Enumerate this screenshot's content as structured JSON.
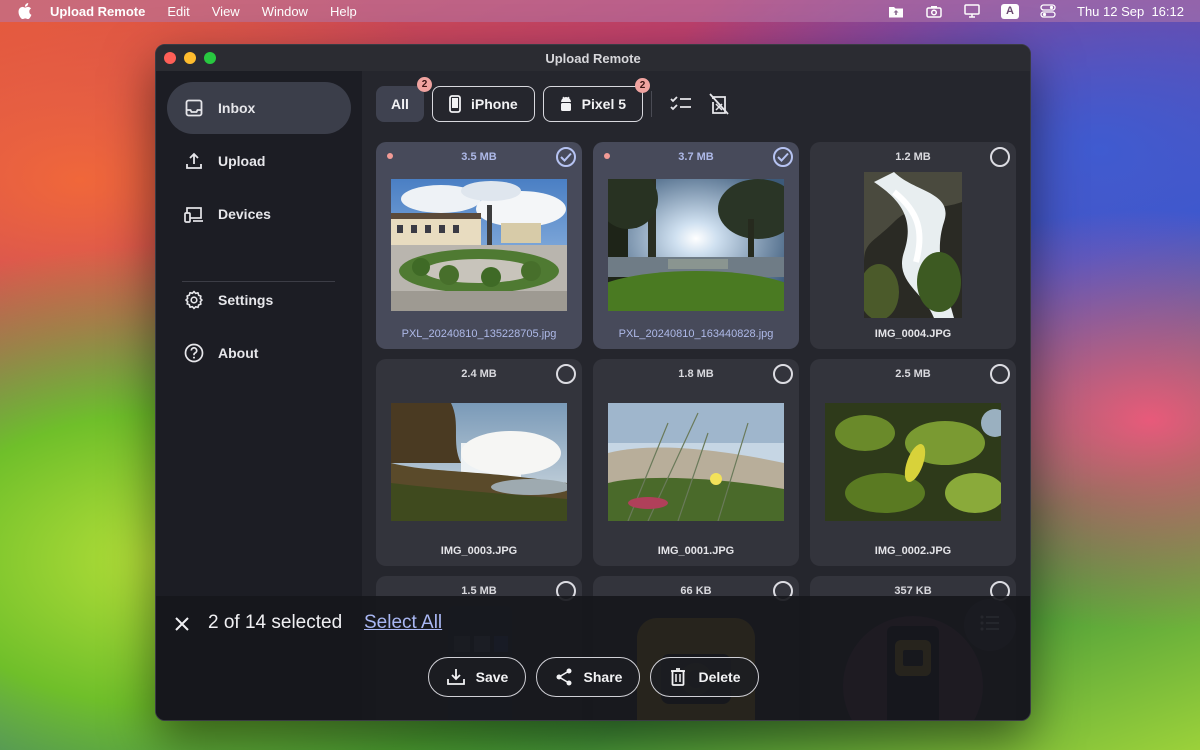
{
  "menubar": {
    "app_name": "Upload Remote",
    "items": [
      "Edit",
      "View",
      "Window",
      "Help"
    ],
    "keyboard_indicator": "A",
    "clock": "Thu 12 Sep  16:12"
  },
  "window": {
    "title": "Upload Remote"
  },
  "sidebar": {
    "items": [
      {
        "label": "Inbox",
        "icon": "inbox-icon",
        "active": true
      },
      {
        "label": "Upload",
        "icon": "upload-icon",
        "active": false
      },
      {
        "label": "Devices",
        "icon": "devices-icon",
        "active": false
      },
      {
        "label": "Settings",
        "icon": "gear-icon",
        "active": false
      },
      {
        "label": "About",
        "icon": "help-circle-icon",
        "active": false
      }
    ]
  },
  "filters": {
    "all": {
      "label": "All",
      "badge": "2"
    },
    "iphone": {
      "label": "iPhone"
    },
    "pixel": {
      "label": "Pixel 5",
      "badge": "2"
    }
  },
  "photos": [
    {
      "size": "3.5 MB",
      "name": "PXL_20240810_135228705.jpg",
      "selected": true,
      "new": true
    },
    {
      "size": "3.7 MB",
      "name": "PXL_20240810_163440828.jpg",
      "selected": true,
      "new": true
    },
    {
      "size": "1.2 MB",
      "name": "IMG_0004.JPG",
      "selected": false,
      "new": false
    },
    {
      "size": "2.4 MB",
      "name": "IMG_0003.JPG",
      "selected": false,
      "new": false
    },
    {
      "size": "1.8 MB",
      "name": "IMG_0001.JPG",
      "selected": false,
      "new": false
    },
    {
      "size": "2.5 MB",
      "name": "IMG_0002.JPG",
      "selected": false,
      "new": false
    },
    {
      "size": "1.5 MB",
      "name": "",
      "selected": false,
      "new": false
    },
    {
      "size": "66 KB",
      "name": "",
      "selected": false,
      "new": false
    },
    {
      "size": "357 KB",
      "name": "",
      "selected": false,
      "new": false
    }
  ],
  "selection": {
    "count_text": "2 of 14 selected",
    "select_all_label": "Select All",
    "save_label": "Save",
    "share_label": "Share",
    "delete_label": "Delete"
  },
  "colors": {
    "accent": "#a9b7f3",
    "badge": "#f0a3a0",
    "sidebar_active": "#3b3e4a",
    "card_selected": "#474a5a"
  }
}
